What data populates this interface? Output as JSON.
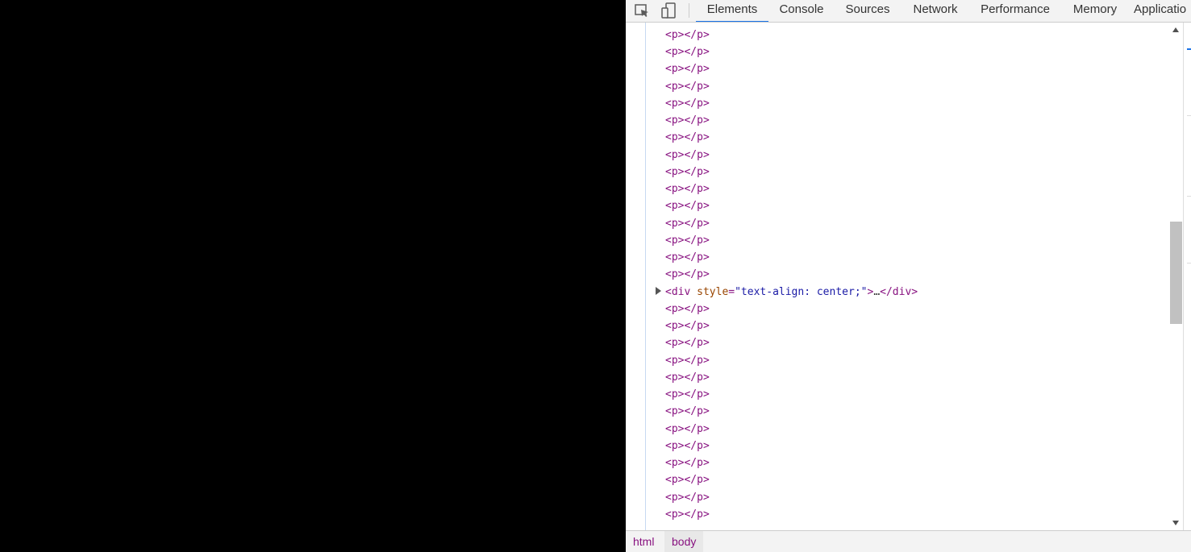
{
  "devtools": {
    "tabs": [
      {
        "label": "Elements",
        "active": true
      },
      {
        "label": "Console",
        "active": false
      },
      {
        "label": "Sources",
        "active": false
      },
      {
        "label": "Network",
        "active": false
      },
      {
        "label": "Performance",
        "active": false
      },
      {
        "label": "Memory",
        "active": false
      },
      {
        "label": "Applicatio",
        "active": false
      }
    ],
    "toolbar_icons": [
      "inspect-element-icon",
      "device-toggle-icon"
    ],
    "dom_lines_before": [
      "<p></p>",
      "<p></p>",
      "<p></p>",
      "<p></p>",
      "<p></p>",
      "<p></p>",
      "<p></p>",
      "<p></p>",
      "<p></p>",
      "<p></p>",
      "<p></p>",
      "<p></p>",
      "<p></p>",
      "<p></p>",
      "<p></p>"
    ],
    "div_node": {
      "open": "<div",
      "attr_name": "style",
      "eq": "=",
      "attr_value": "\"text-align: center;\"",
      "gt": ">",
      "ellipsis": "…",
      "close": "</div>"
    },
    "dom_lines_after": [
      "<p></p>",
      "<p></p>",
      "<p></p>",
      "<p></p>",
      "<p></p>",
      "<p></p>",
      "<p></p>",
      "<p></p>",
      "<p></p>",
      "<p></p>",
      "<p></p>",
      "<p></p>",
      "<p></p>"
    ],
    "breadcrumbs": [
      {
        "label": "html",
        "selected": false
      },
      {
        "label": "body",
        "selected": true
      }
    ],
    "accent_color": "#1a73e8",
    "tag_color": "#881280",
    "attr_name_color": "#994500",
    "attr_value_color": "#1a1aa6"
  }
}
